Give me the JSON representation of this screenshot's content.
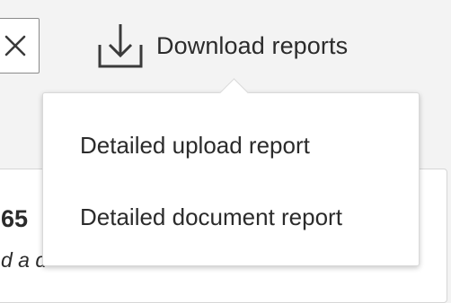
{
  "close_button": {
    "icon": "close-icon"
  },
  "download": {
    "label": "Download reports",
    "icon": "download-icon"
  },
  "dropdown": {
    "items": [
      {
        "label": "Detailed upload report"
      },
      {
        "label": "Detailed document report"
      }
    ]
  },
  "background_card": {
    "count_text": "65",
    "subtext": "d a d"
  },
  "colors": {
    "text": "#2b2b2b",
    "border": "#8a8a8a",
    "page_background": "#f3f3f3",
    "menu_background": "#ffffff"
  }
}
